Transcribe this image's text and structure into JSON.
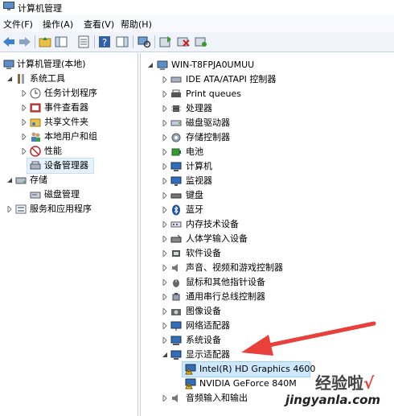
{
  "window": {
    "title": "计算机管理"
  },
  "menu": [
    "文件(F)",
    "操作(A)",
    "查看(V)",
    "帮助(H)"
  ],
  "left_tree": [
    {
      "label": "计算机管理(本地)",
      "icon": "computer-management-icon"
    },
    {
      "label": "系统工具",
      "icon": "tools-icon"
    },
    {
      "label": "任务计划程序",
      "icon": "clock-icon"
    },
    {
      "label": "事件查看器",
      "icon": "event-viewer-icon"
    },
    {
      "label": "共享文件夹",
      "icon": "shared-folder-icon"
    },
    {
      "label": "本地用户和组",
      "icon": "users-icon"
    },
    {
      "label": "性能",
      "icon": "performance-icon"
    },
    {
      "label": "设备管理器",
      "icon": "device-manager-icon"
    },
    {
      "label": "存储",
      "icon": "storage-icon"
    },
    {
      "label": "磁盘管理",
      "icon": "disk-management-icon"
    },
    {
      "label": "服务和应用程序",
      "icon": "services-icon"
    }
  ],
  "device_tree": {
    "root": "WIN-T8FPJA0UMUU",
    "categories": [
      "IDE ATA/ATAPI 控制器",
      "Print queues",
      "处理器",
      "磁盘驱动器",
      "存储控制器",
      "电池",
      "计算机",
      "监视器",
      "键盘",
      "蓝牙",
      "内存技术设备",
      "人体学输入设备",
      "软件设备",
      "声音、视频和游戏控制器",
      "鼠标和其他指针设备",
      "通用串行总线控制器",
      "图像设备",
      "网络适配器",
      "系统设备",
      "显示适配器",
      "音频输入和输出"
    ],
    "display_adapters": [
      "Intel(R) HD Graphics 4600",
      "NVIDIA GeForce 840M"
    ]
  },
  "watermark": {
    "line1": "经验啦",
    "check": "√",
    "line2": "jingyanla.com"
  },
  "colors": {
    "selection": "#cde8ff",
    "arrow": "#e8403a",
    "warning": "#f5c400"
  }
}
